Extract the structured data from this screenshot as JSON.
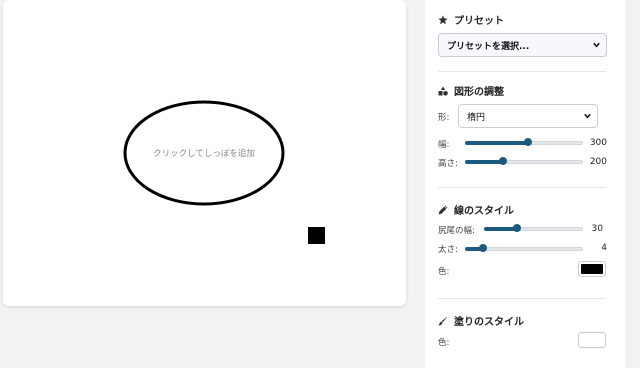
{
  "canvas": {
    "bubble_text": "クリックしてしっぽを追加"
  },
  "presets": {
    "title": "プリセット",
    "icon": "star-icon",
    "selected": "プリセットを選択..."
  },
  "shape": {
    "title": "図形の調整",
    "icon": "shapes-icon",
    "shape_label": "形:",
    "shape_selected": "楕円",
    "width_label": "幅:",
    "width_value": "300",
    "width_fraction": 0.53,
    "height_label": "高さ:",
    "height_value": "200",
    "height_fraction": 0.32
  },
  "line": {
    "title": "線のスタイル",
    "icon": "pen-icon",
    "tail_width_label": "尻尾の幅:",
    "tail_width_value": "30",
    "tail_width_fraction": 0.33,
    "thickness_label": "太さ:",
    "thickness_value": "4",
    "thickness_fraction": 0.15,
    "color_label": "色:",
    "color": "#000000"
  },
  "fill": {
    "title": "塗りのスタイル",
    "icon": "brush-icon",
    "color_label": "色:",
    "color": "#ffffff"
  },
  "colors": {
    "accent": "#1d5a80"
  }
}
